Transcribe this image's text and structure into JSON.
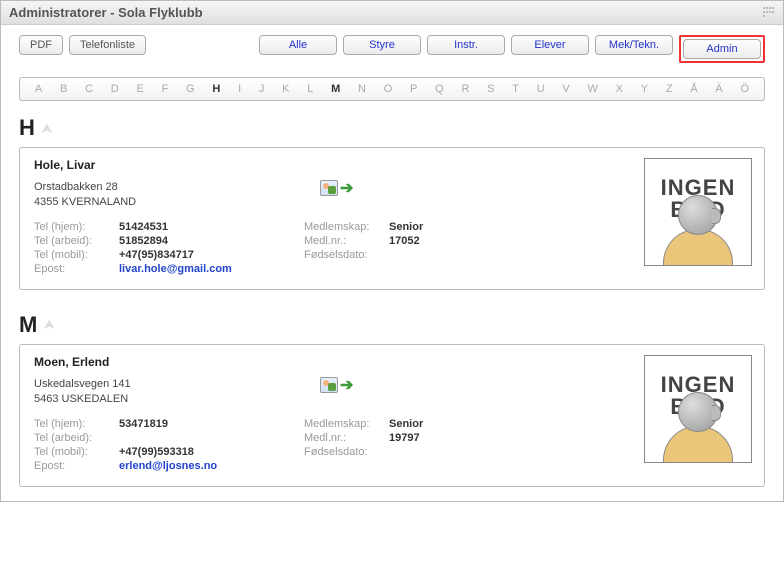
{
  "title": "Administratorer - Sola Flyklubb",
  "toolbar": {
    "pdf": "PDF",
    "telefonliste": "Telefonliste",
    "filters": {
      "alle": "Alle",
      "styre": "Styre",
      "instr": "Instr.",
      "elever": "Elever",
      "mektekn": "Mek/Tekn.",
      "admin": "Admin"
    }
  },
  "alphabet": [
    "A",
    "B",
    "C",
    "D",
    "E",
    "F",
    "G",
    "H",
    "I",
    "J",
    "K",
    "L",
    "M",
    "N",
    "O",
    "P",
    "Q",
    "R",
    "S",
    "T",
    "U",
    "V",
    "W",
    "X",
    "Y",
    "Z",
    "Å",
    "Ä",
    "Ö"
  ],
  "active_letters": [
    "H",
    "M"
  ],
  "labels": {
    "tel_hjem": "Tel (hjem):",
    "tel_arbeid": "Tel (arbeid):",
    "tel_mobil": "Tel (mobil):",
    "epost": "Epost:",
    "medlemskap": "Medlemskap:",
    "medlnr": "Medl.nr.:",
    "fodselsdato": "Fødselsdato:"
  },
  "no_image": {
    "line1": "INGEN",
    "line2": "BILD"
  },
  "sections": [
    {
      "letter": "H",
      "member": {
        "name": "Hole, Livar",
        "addr1": "Orstadbakken 28",
        "addr2": "4355 KVERNALAND",
        "tel_hjem": "51424531",
        "tel_arbeid": "51852894",
        "tel_mobil": "+47(95)834717",
        "epost": "livar.hole@gmail.com",
        "medlemskap": "Senior",
        "medlnr": "17052",
        "fodselsdato": ""
      }
    },
    {
      "letter": "M",
      "member": {
        "name": "Moen, Erlend",
        "addr1": "Uskedalsvegen 141",
        "addr2": "5463 USKEDALEN",
        "tel_hjem": "53471819",
        "tel_arbeid": "",
        "tel_mobil": "+47(99)593318",
        "epost": "erlend@ljosnes.no",
        "medlemskap": "Senior",
        "medlnr": "19797",
        "fodselsdato": ""
      }
    }
  ]
}
